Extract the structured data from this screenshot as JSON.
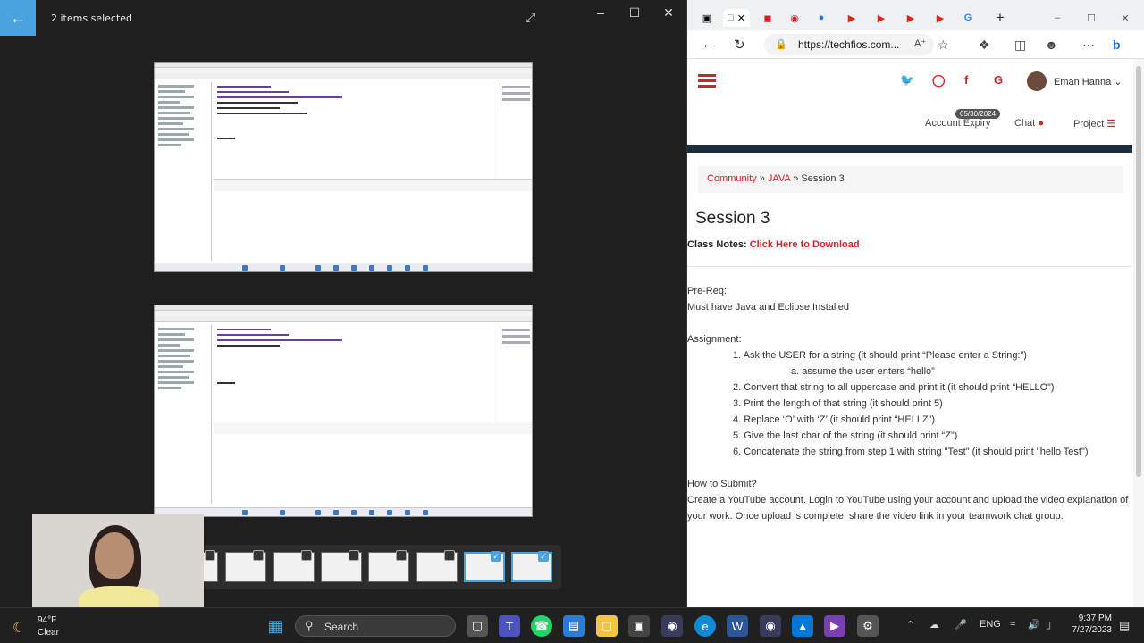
{
  "viewer": {
    "selection_label": "2 items selected",
    "back_icon": "back-arrow-icon",
    "expand_icon": "expand-icon"
  },
  "browser": {
    "url": "https://techfios.com...",
    "nav": {
      "username": "Eman Hanna ⌄",
      "expiry_badge": "05/30/2024",
      "account_expiry": "Account Expiry",
      "chat": "Chat",
      "project": "Project"
    },
    "breadcrumb": {
      "community": "Community",
      "sep1": "»",
      "java": "JAVA",
      "sep2": "»",
      "current": "Session 3"
    },
    "title": "Session 3",
    "class_notes_label": "Class Notes:",
    "class_notes_link": "Click Here to Download",
    "prereq_heading": "Pre-Req:",
    "prereq_text": "Must have Java and Eclipse Installed",
    "assignment_heading": "Assignment:",
    "tasks": [
      "1. Ask the USER for a string (it should print “Please enter a String:”)",
      "2. Convert that string to all uppercase and print it (it should print “HELLO”)",
      "3. Print the length of that string (it should print 5)",
      "4. Replace ‘O’ with ‘Z’ (it should print “HELLZ”)",
      "5. Give the last char of the string (it should print “Z”)",
      "6. Concatenate the string from step 1 with string \"Test\" (it should print \"hello Test\")"
    ],
    "subtask": "a. assume the user enters “hello”",
    "submit_heading": "How to Submit?",
    "submit_line1": "Create a YouTube account. Login to YouTube using your account and upload the video explanation of",
    "submit_line2": "your work. Once upload is complete, share the video link in your teamwork chat group."
  },
  "taskbar": {
    "temp": "94°F",
    "condition": "Clear",
    "search_label": "Search",
    "language": "ENG",
    "time": "9:37 PM",
    "date": "7/27/2023"
  },
  "colors": {
    "accent_red": "#d2232a",
    "viewer_accent": "#4aa3df",
    "header_bar": "#1f2d3d"
  }
}
